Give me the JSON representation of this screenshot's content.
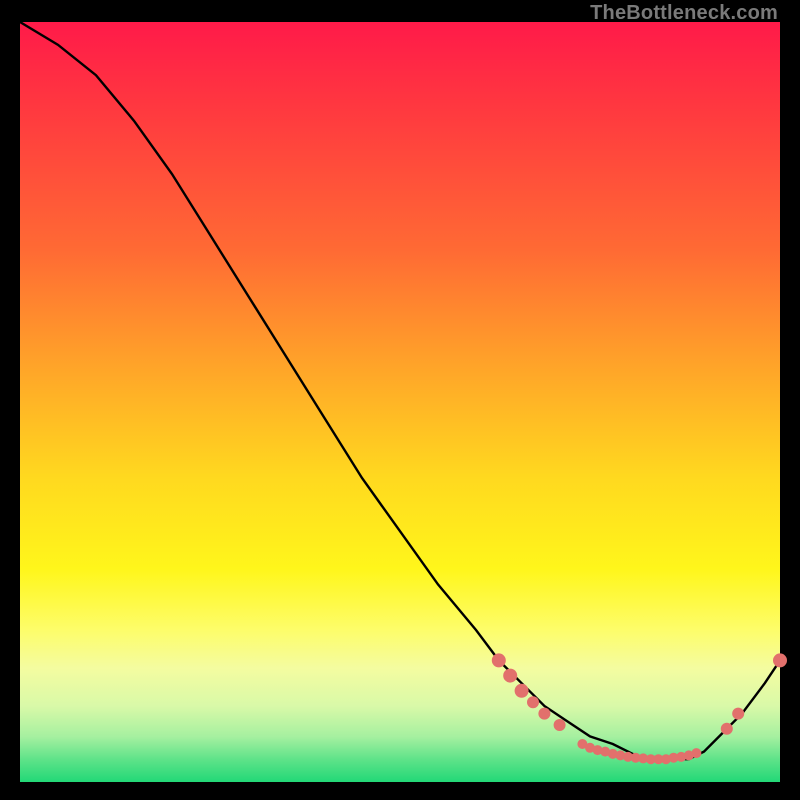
{
  "watermark": "TheBottleneck.com",
  "chart_data": {
    "type": "line",
    "title": "",
    "xlabel": "",
    "ylabel": "",
    "xlim": [
      0,
      100
    ],
    "ylim": [
      0,
      100
    ],
    "grid": false,
    "legend": false,
    "series": [
      {
        "name": "curve",
        "color": "#000000",
        "x": [
          0,
          5,
          10,
          15,
          20,
          25,
          30,
          35,
          40,
          45,
          50,
          55,
          60,
          63,
          66,
          69,
          72,
          75,
          78,
          80,
          82,
          84,
          86,
          88,
          90,
          92,
          95,
          98,
          100
        ],
        "y": [
          100,
          97,
          93,
          87,
          80,
          72,
          64,
          56,
          48,
          40,
          33,
          26,
          20,
          16,
          13,
          10,
          8,
          6,
          5,
          4,
          3,
          3,
          3,
          3,
          4,
          6,
          9,
          13,
          16
        ]
      }
    ],
    "markers": {
      "color": "#e2706c",
      "radius_small": 5,
      "radius_large": 7,
      "points": [
        {
          "x": 63,
          "y": 16,
          "r": 7
        },
        {
          "x": 64.5,
          "y": 14,
          "r": 7
        },
        {
          "x": 66,
          "y": 12,
          "r": 7
        },
        {
          "x": 67.5,
          "y": 10.5,
          "r": 6
        },
        {
          "x": 69,
          "y": 9,
          "r": 6
        },
        {
          "x": 71,
          "y": 7.5,
          "r": 6
        },
        {
          "x": 74,
          "y": 5,
          "r": 5
        },
        {
          "x": 75,
          "y": 4.5,
          "r": 5
        },
        {
          "x": 76,
          "y": 4.2,
          "r": 5
        },
        {
          "x": 77,
          "y": 4.0,
          "r": 5
        },
        {
          "x": 78,
          "y": 3.7,
          "r": 5
        },
        {
          "x": 79,
          "y": 3.5,
          "r": 5
        },
        {
          "x": 80,
          "y": 3.3,
          "r": 5
        },
        {
          "x": 81,
          "y": 3.2,
          "r": 5
        },
        {
          "x": 82,
          "y": 3.1,
          "r": 5
        },
        {
          "x": 83,
          "y": 3.0,
          "r": 5
        },
        {
          "x": 84,
          "y": 3.0,
          "r": 5
        },
        {
          "x": 85,
          "y": 3.0,
          "r": 5
        },
        {
          "x": 86,
          "y": 3.2,
          "r": 5
        },
        {
          "x": 87,
          "y": 3.3,
          "r": 5
        },
        {
          "x": 88,
          "y": 3.5,
          "r": 5
        },
        {
          "x": 89,
          "y": 3.8,
          "r": 5
        },
        {
          "x": 93,
          "y": 7,
          "r": 6
        },
        {
          "x": 94.5,
          "y": 9,
          "r": 6
        },
        {
          "x": 100,
          "y": 16,
          "r": 7
        }
      ]
    }
  }
}
